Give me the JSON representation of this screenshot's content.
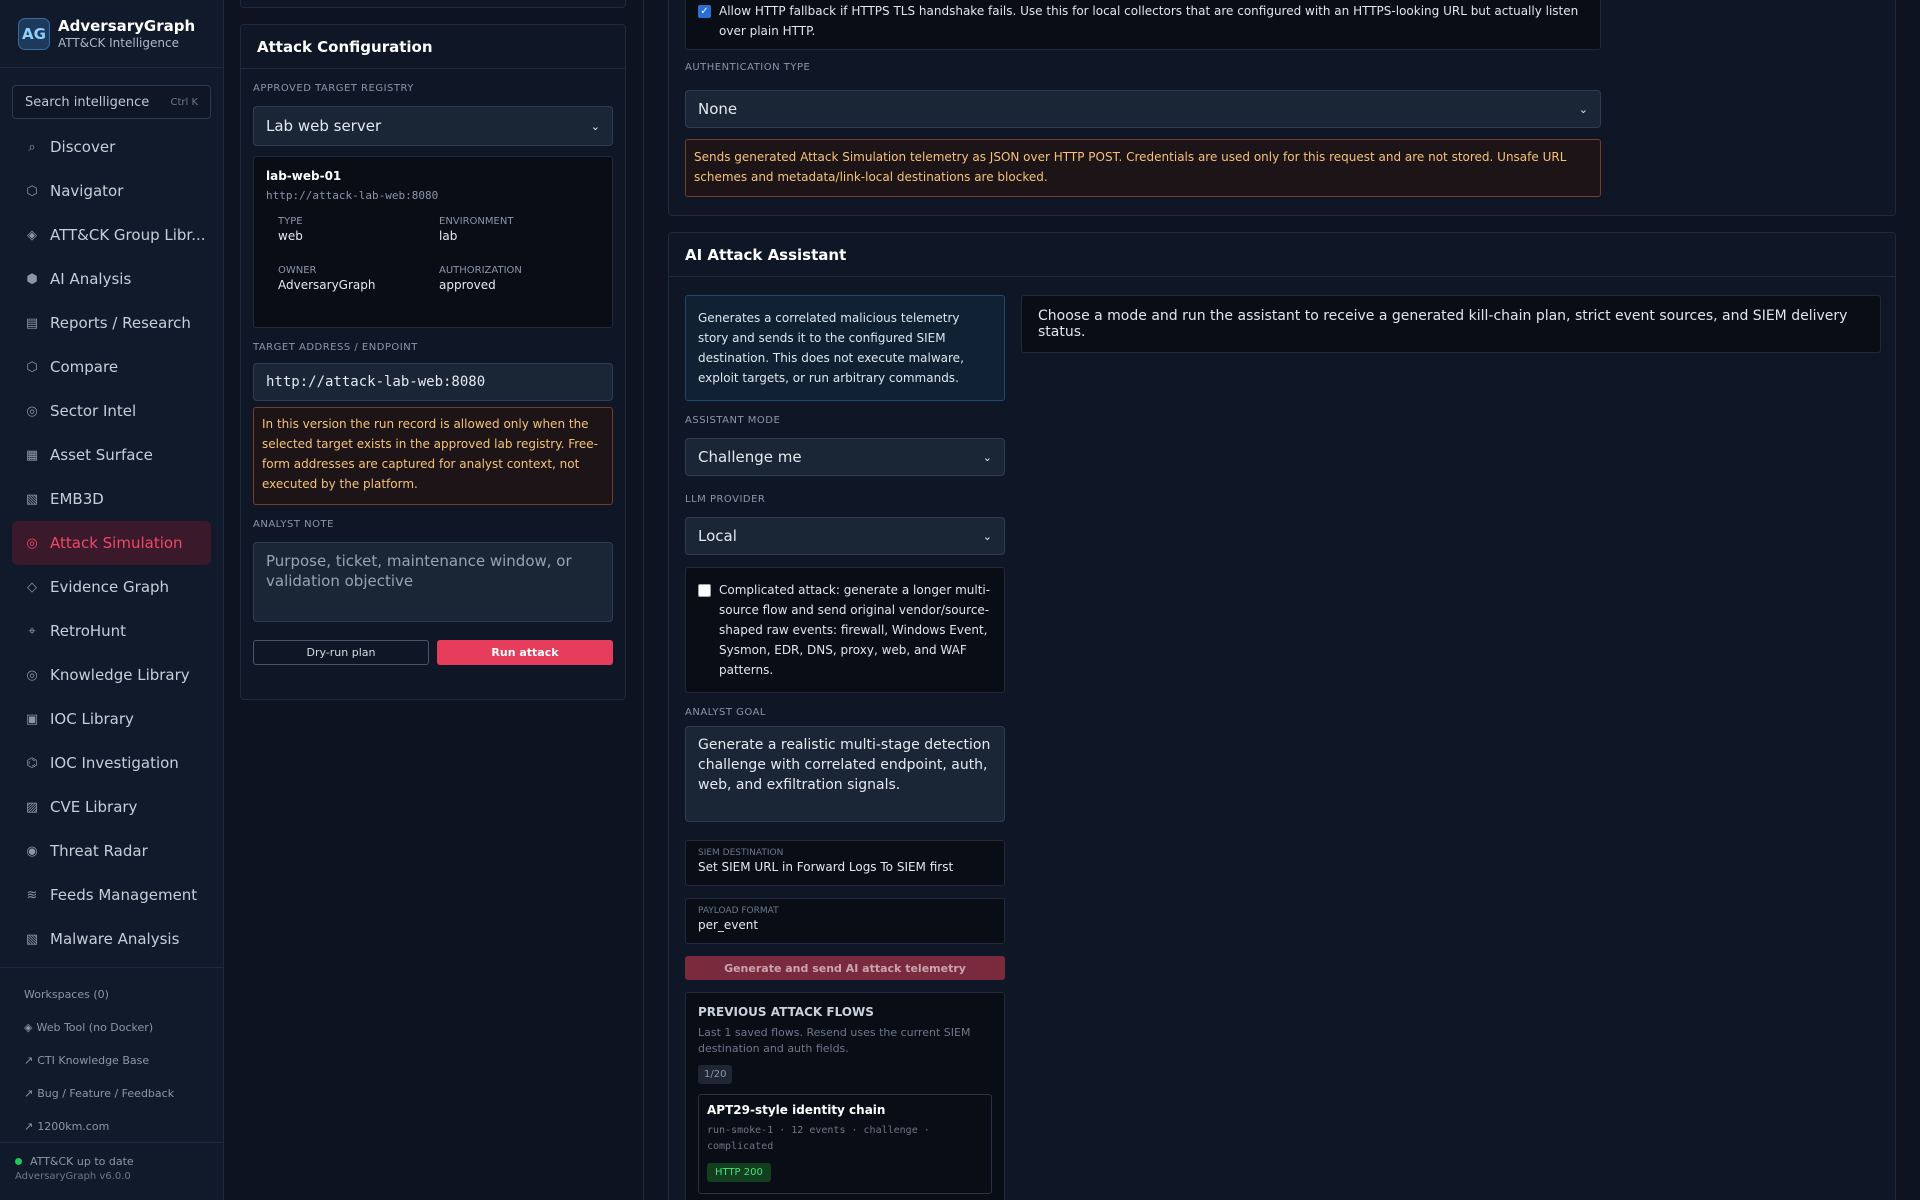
{
  "brand": {
    "logo": "AG",
    "title": "AdversaryGraph",
    "subtitle": "ATT&CK Intelligence"
  },
  "search": {
    "placeholder": "Search intelligence",
    "shortcut": "Ctrl K"
  },
  "nav": [
    {
      "icon": "⌕",
      "label": "Discover"
    },
    {
      "icon": "⬡",
      "label": "Navigator"
    },
    {
      "icon": "◈",
      "label": "ATT&CK Group Libr..."
    },
    {
      "icon": "⬢",
      "label": "AI Analysis"
    },
    {
      "icon": "▤",
      "label": "Reports / Research"
    },
    {
      "icon": "⬡",
      "label": "Compare"
    },
    {
      "icon": "◎",
      "label": "Sector Intel"
    },
    {
      "icon": "▦",
      "label": "Asset Surface"
    },
    {
      "icon": "▧",
      "label": "EMB3D"
    },
    {
      "icon": "◎",
      "label": "Attack Simulation",
      "active": true
    },
    {
      "icon": "◇",
      "label": "Evidence Graph"
    },
    {
      "icon": "⌖",
      "label": "RetroHunt"
    },
    {
      "icon": "◎",
      "label": "Knowledge Library"
    },
    {
      "icon": "▣",
      "label": "IOC Library"
    },
    {
      "icon": "⌬",
      "label": "IOC Investigation"
    },
    {
      "icon": "▨",
      "label": "CVE Library"
    },
    {
      "icon": "◉",
      "label": "Threat Radar"
    },
    {
      "icon": "≋",
      "label": "Feeds Management"
    },
    {
      "icon": "▧",
      "label": "Malware Analysis"
    }
  ],
  "side_links": [
    {
      "icon": "",
      "label": "Workspaces (0)"
    },
    {
      "icon": "◈",
      "label": "Web Tool (no Docker)"
    },
    {
      "icon": "↗",
      "label": "CTI Knowledge Base"
    },
    {
      "icon": "↗",
      "label": "Bug / Feature / Feedback"
    },
    {
      "icon": "↗",
      "label": "1200km.com"
    }
  ],
  "footer": {
    "status": "ATT&CK up to date",
    "version": "AdversaryGraph v6.0.0"
  },
  "config": {
    "title": "Attack Configuration",
    "registry_label": "APPROVED TARGET REGISTRY",
    "registry_value": "Lab web server",
    "target": {
      "name": "lab-web-01",
      "url": "http://attack-lab-web:8080",
      "type_label": "TYPE",
      "type": "web",
      "env_label": "ENVIRONMENT",
      "env": "lab",
      "owner_label": "OWNER",
      "owner": "AdversaryGraph",
      "auth_label": "AUTHORIZATION",
      "auth": "approved"
    },
    "endpoint_label": "TARGET ADDRESS / ENDPOINT",
    "endpoint_value": "http://attack-lab-web:8080",
    "warning": "In this version the run record is allowed only when the selected target exists in the approved lab registry. Free-form addresses are captured for analyst context, not executed by the platform.",
    "note_label": "ANALYST NOTE",
    "note_placeholder": "Purpose, ticket, maintenance window, or validation objective",
    "dry_run": "Dry-run plan",
    "run": "Run attack"
  },
  "siem": {
    "fallback_text": "Allow HTTP fallback if HTTPS TLS handshake fails. Use this for local collectors that are configured with an HTTPS-looking URL but actually listen over plain HTTP.",
    "auth_label": "AUTHENTICATION TYPE",
    "auth_value": "None",
    "warning": "Sends generated Attack Simulation telemetry as JSON over HTTP POST. Credentials are used only for this request and are not stored. Unsafe URL schemes and metadata/link-local destinations are blocked."
  },
  "assistant": {
    "title": "AI Attack Assistant",
    "info": "Generates a correlated malicious telemetry story and sends it to the configured SIEM destination. This does not execute malware, exploit targets, or run arbitrary commands.",
    "result_text": "Choose a mode and run the assistant to receive a generated kill-chain plan, strict event sources, and SIEM delivery status.",
    "mode_label": "ASSISTANT MODE",
    "mode_value": "Challenge me",
    "provider_label": "LLM PROVIDER",
    "provider_value": "Local",
    "complicated_text": "Complicated attack: generate a longer multi-source flow and send original vendor/source-shaped raw events: firewall, Windows Event, Sysmon, EDR, DNS, proxy, web, and WAF patterns.",
    "goal_label": "ANALYST GOAL",
    "goal_value": "Generate a realistic multi-stage detection challenge with correlated endpoint, auth, web, and exfiltration signals.",
    "siem_dest_label": "SIEM DESTINATION",
    "siem_dest_value": "Set SIEM URL in Forward Logs To SIEM first",
    "payload_label": "PAYLOAD FORMAT",
    "payload_value": "per_event",
    "generate_btn": "Generate and send AI attack telemetry",
    "prev_title": "PREVIOUS ATTACK FLOWS",
    "prev_desc": "Last 1 saved flows. Resend uses the current SIEM destination and auth fields.",
    "prev_count": "1/20",
    "flow_title": "APT29-style identity chain",
    "flow_meta": "run-smoke-1 · 12 events · challenge · complicated",
    "flow_status": "HTTP 200"
  }
}
